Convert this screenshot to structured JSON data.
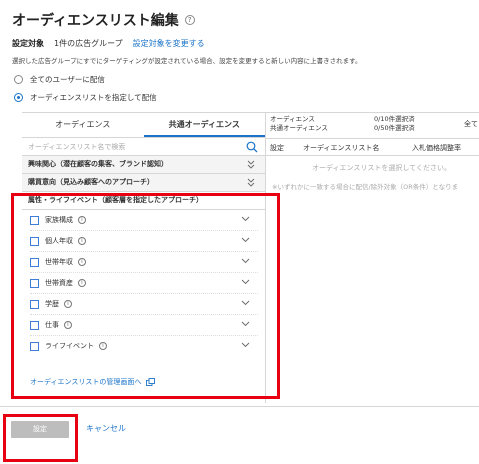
{
  "page": {
    "title": "オーディエンスリスト編集",
    "help_glyph": "?"
  },
  "target": {
    "label": "設定対象",
    "value": "1件の広告グループ",
    "change_link": "設定対象を変更する"
  },
  "notice": "選択した広告グループにすでにターゲティングが設定されている場合、設定を変更すると新しい内容に上書きされます。",
  "radio": {
    "all_users": "全てのユーザーに配信",
    "specify": "オーディエンスリストを指定して配信",
    "selected": "specify"
  },
  "tabs": {
    "audience": "オーディエンス",
    "shared_audience": "共通オーディエンス",
    "active": "shared_audience"
  },
  "search": {
    "placeholder": "オーディエンスリスト名で検索"
  },
  "categories": {
    "interest": "興味関心（潜在顧客の集客、ブランド認知）",
    "purchase": "購買意向（見込み顧客へのアプローチ）",
    "attributes": "属性・ライフイベント（顧客層を指定したアプローチ）"
  },
  "attribute_items": [
    {
      "label": "家族構成",
      "checked": false
    },
    {
      "label": "個人年収",
      "checked": false
    },
    {
      "label": "世帯年収",
      "checked": false
    },
    {
      "label": "世帯資産",
      "checked": false
    },
    {
      "label": "学歴",
      "checked": false
    },
    {
      "label": "仕事",
      "checked": false
    },
    {
      "label": "ライフイベント",
      "checked": false
    }
  ],
  "manage_link": "オーディエンスリストの管理画面へ",
  "summary": {
    "audience_label": "オーディエンス",
    "shared_label": "共通オーディエンス",
    "audience_count": "0/10件選択済",
    "shared_count": "0/50件選択済",
    "all_label": "全て"
  },
  "columns": {
    "setting": "設定",
    "list_name": "オーディエンスリスト名",
    "bid_adjust": "入札価格調整率"
  },
  "empty": {
    "message": "オーディエンスリストを選択してください。",
    "note": "※いずれかに一致する場合に配信/除外対象（OR条件）となりま"
  },
  "footer": {
    "set_button": "設定",
    "cancel_link": "キャンセル"
  },
  "colors": {
    "link": "#1a73c8",
    "highlight": "#e60012",
    "disabled_button": "#bdbdbd"
  }
}
